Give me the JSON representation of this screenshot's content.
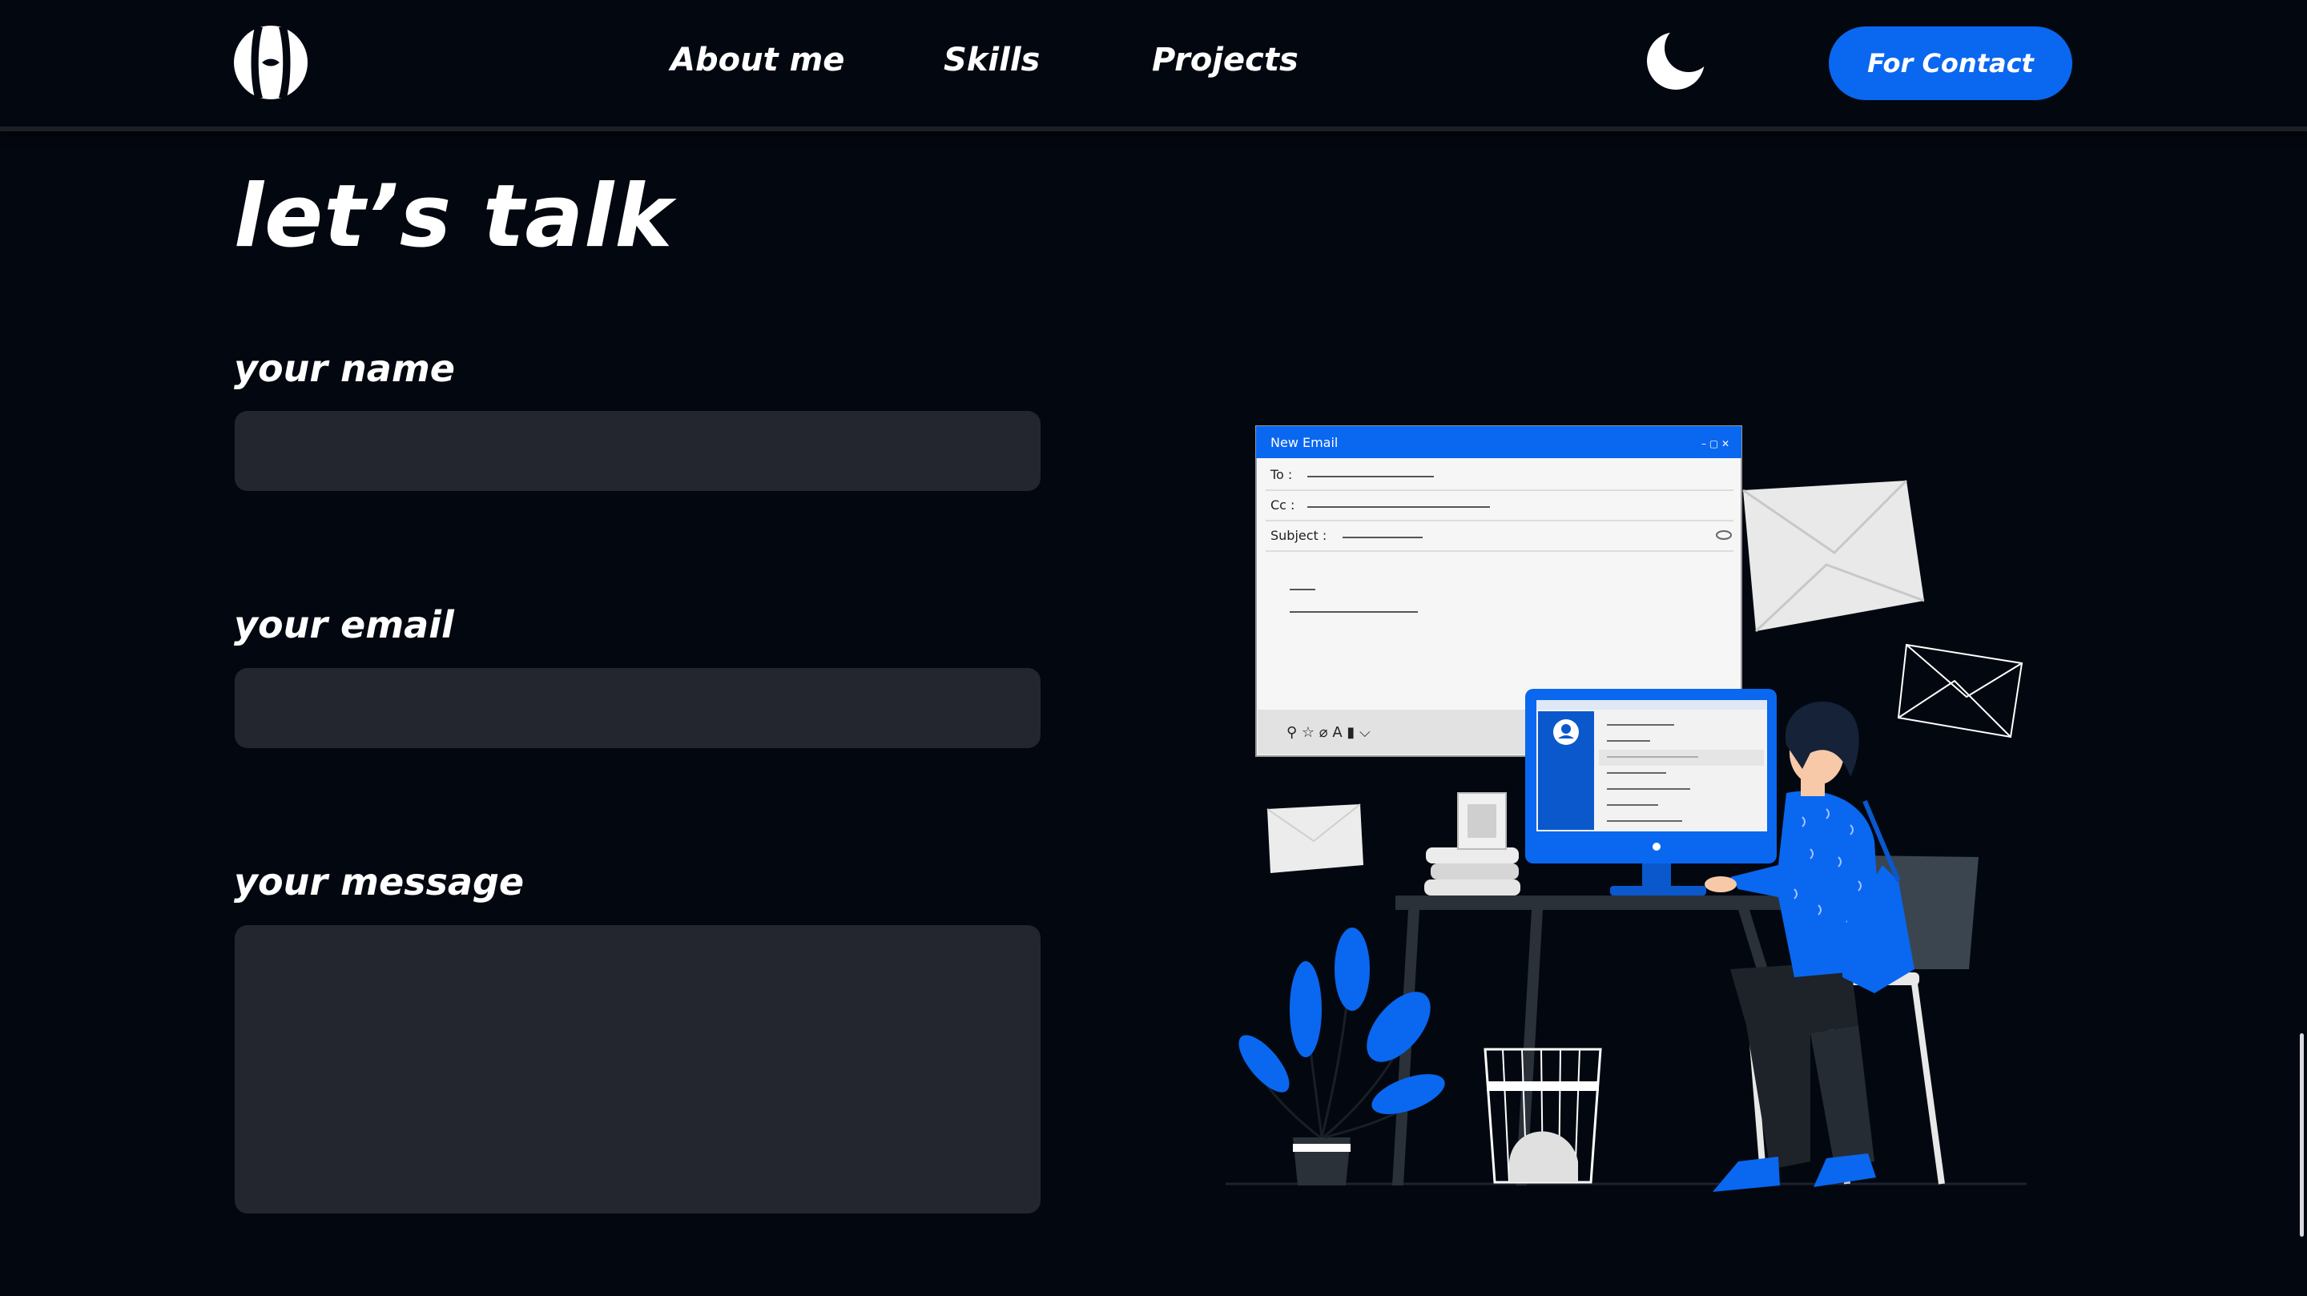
{
  "nav": {
    "logo_icon": "h-logo-icon",
    "links": [
      "About me",
      "Skills",
      "Projects"
    ],
    "theme_icon": "moon-icon",
    "contact_label": "For Contact"
  },
  "page": {
    "title": "let’s talk"
  },
  "form": {
    "name_label": "your name",
    "name_value": "",
    "email_label": "your email",
    "email_value": "",
    "message_label": "your message",
    "message_value": ""
  },
  "illustration": {
    "window_title": "New Email",
    "to_label": "To :",
    "cc_label": "Cc :",
    "subject_label": "Subject :"
  },
  "colors": {
    "background": "#030810",
    "accent": "#0a67f0",
    "input_bg": "#23262e",
    "text": "#ffffff"
  }
}
